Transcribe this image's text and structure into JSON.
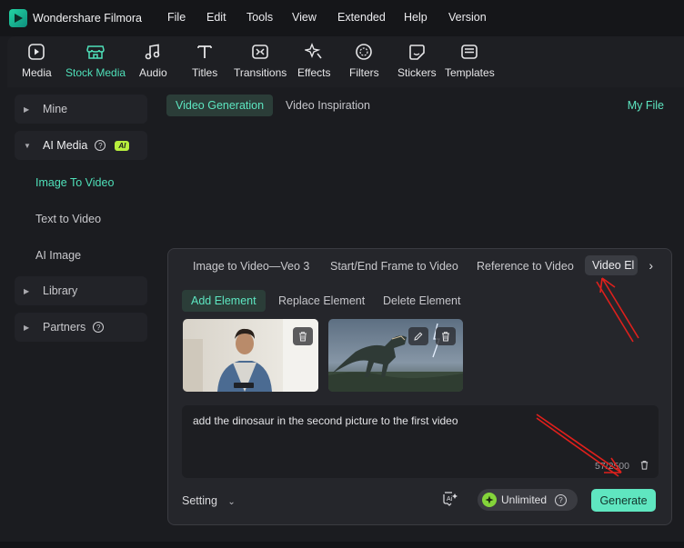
{
  "app": {
    "title": "Wondershare Filmora"
  },
  "menu": [
    "File",
    "Edit",
    "Tools",
    "View",
    "Extended",
    "Help",
    "Version"
  ],
  "toolbar": {
    "items": [
      {
        "label": "Media",
        "icon": "media-icon"
      },
      {
        "label": "Stock Media",
        "icon": "stock-media-icon"
      },
      {
        "label": "Audio",
        "icon": "audio-icon"
      },
      {
        "label": "Titles",
        "icon": "titles-icon"
      },
      {
        "label": "Transitions",
        "icon": "transitions-icon"
      },
      {
        "label": "Effects",
        "icon": "effects-icon"
      },
      {
        "label": "Filters",
        "icon": "filters-icon"
      },
      {
        "label": "Stickers",
        "icon": "stickers-icon"
      },
      {
        "label": "Templates",
        "icon": "templates-icon"
      }
    ],
    "active": "Stock Media"
  },
  "sidebar": {
    "mine": "Mine",
    "ai_media": "AI Media",
    "ai_badge": "AI",
    "sub_items": [
      "Image To Video",
      "Text to Video",
      "AI Image"
    ],
    "active_sub": "Image To Video",
    "library": "Library",
    "partners": "Partners"
  },
  "main": {
    "tabs": [
      "Video Generation",
      "Video Inspiration"
    ],
    "active_tab": "Video Generation",
    "my_file": "My File"
  },
  "panel": {
    "mode_tabs": [
      "Image to Video—Veo 3",
      "Start/End Frame to Video",
      "Reference to Video",
      "Video Elements"
    ],
    "active_mode_visible": "Video El",
    "element_tabs": [
      "Add Element",
      "Replace Element",
      "Delete Element"
    ],
    "active_element_tab": "Add Element",
    "prompt": "add the dinosaur in the second picture to the first video",
    "counter": "57/2500",
    "setting": "Setting",
    "unlimited": "Unlimited",
    "generate": "Generate"
  },
  "colors": {
    "accent": "#5de6c1",
    "background": "#1b1c20",
    "panel": "#25262b",
    "annotation": "#e0201c"
  }
}
